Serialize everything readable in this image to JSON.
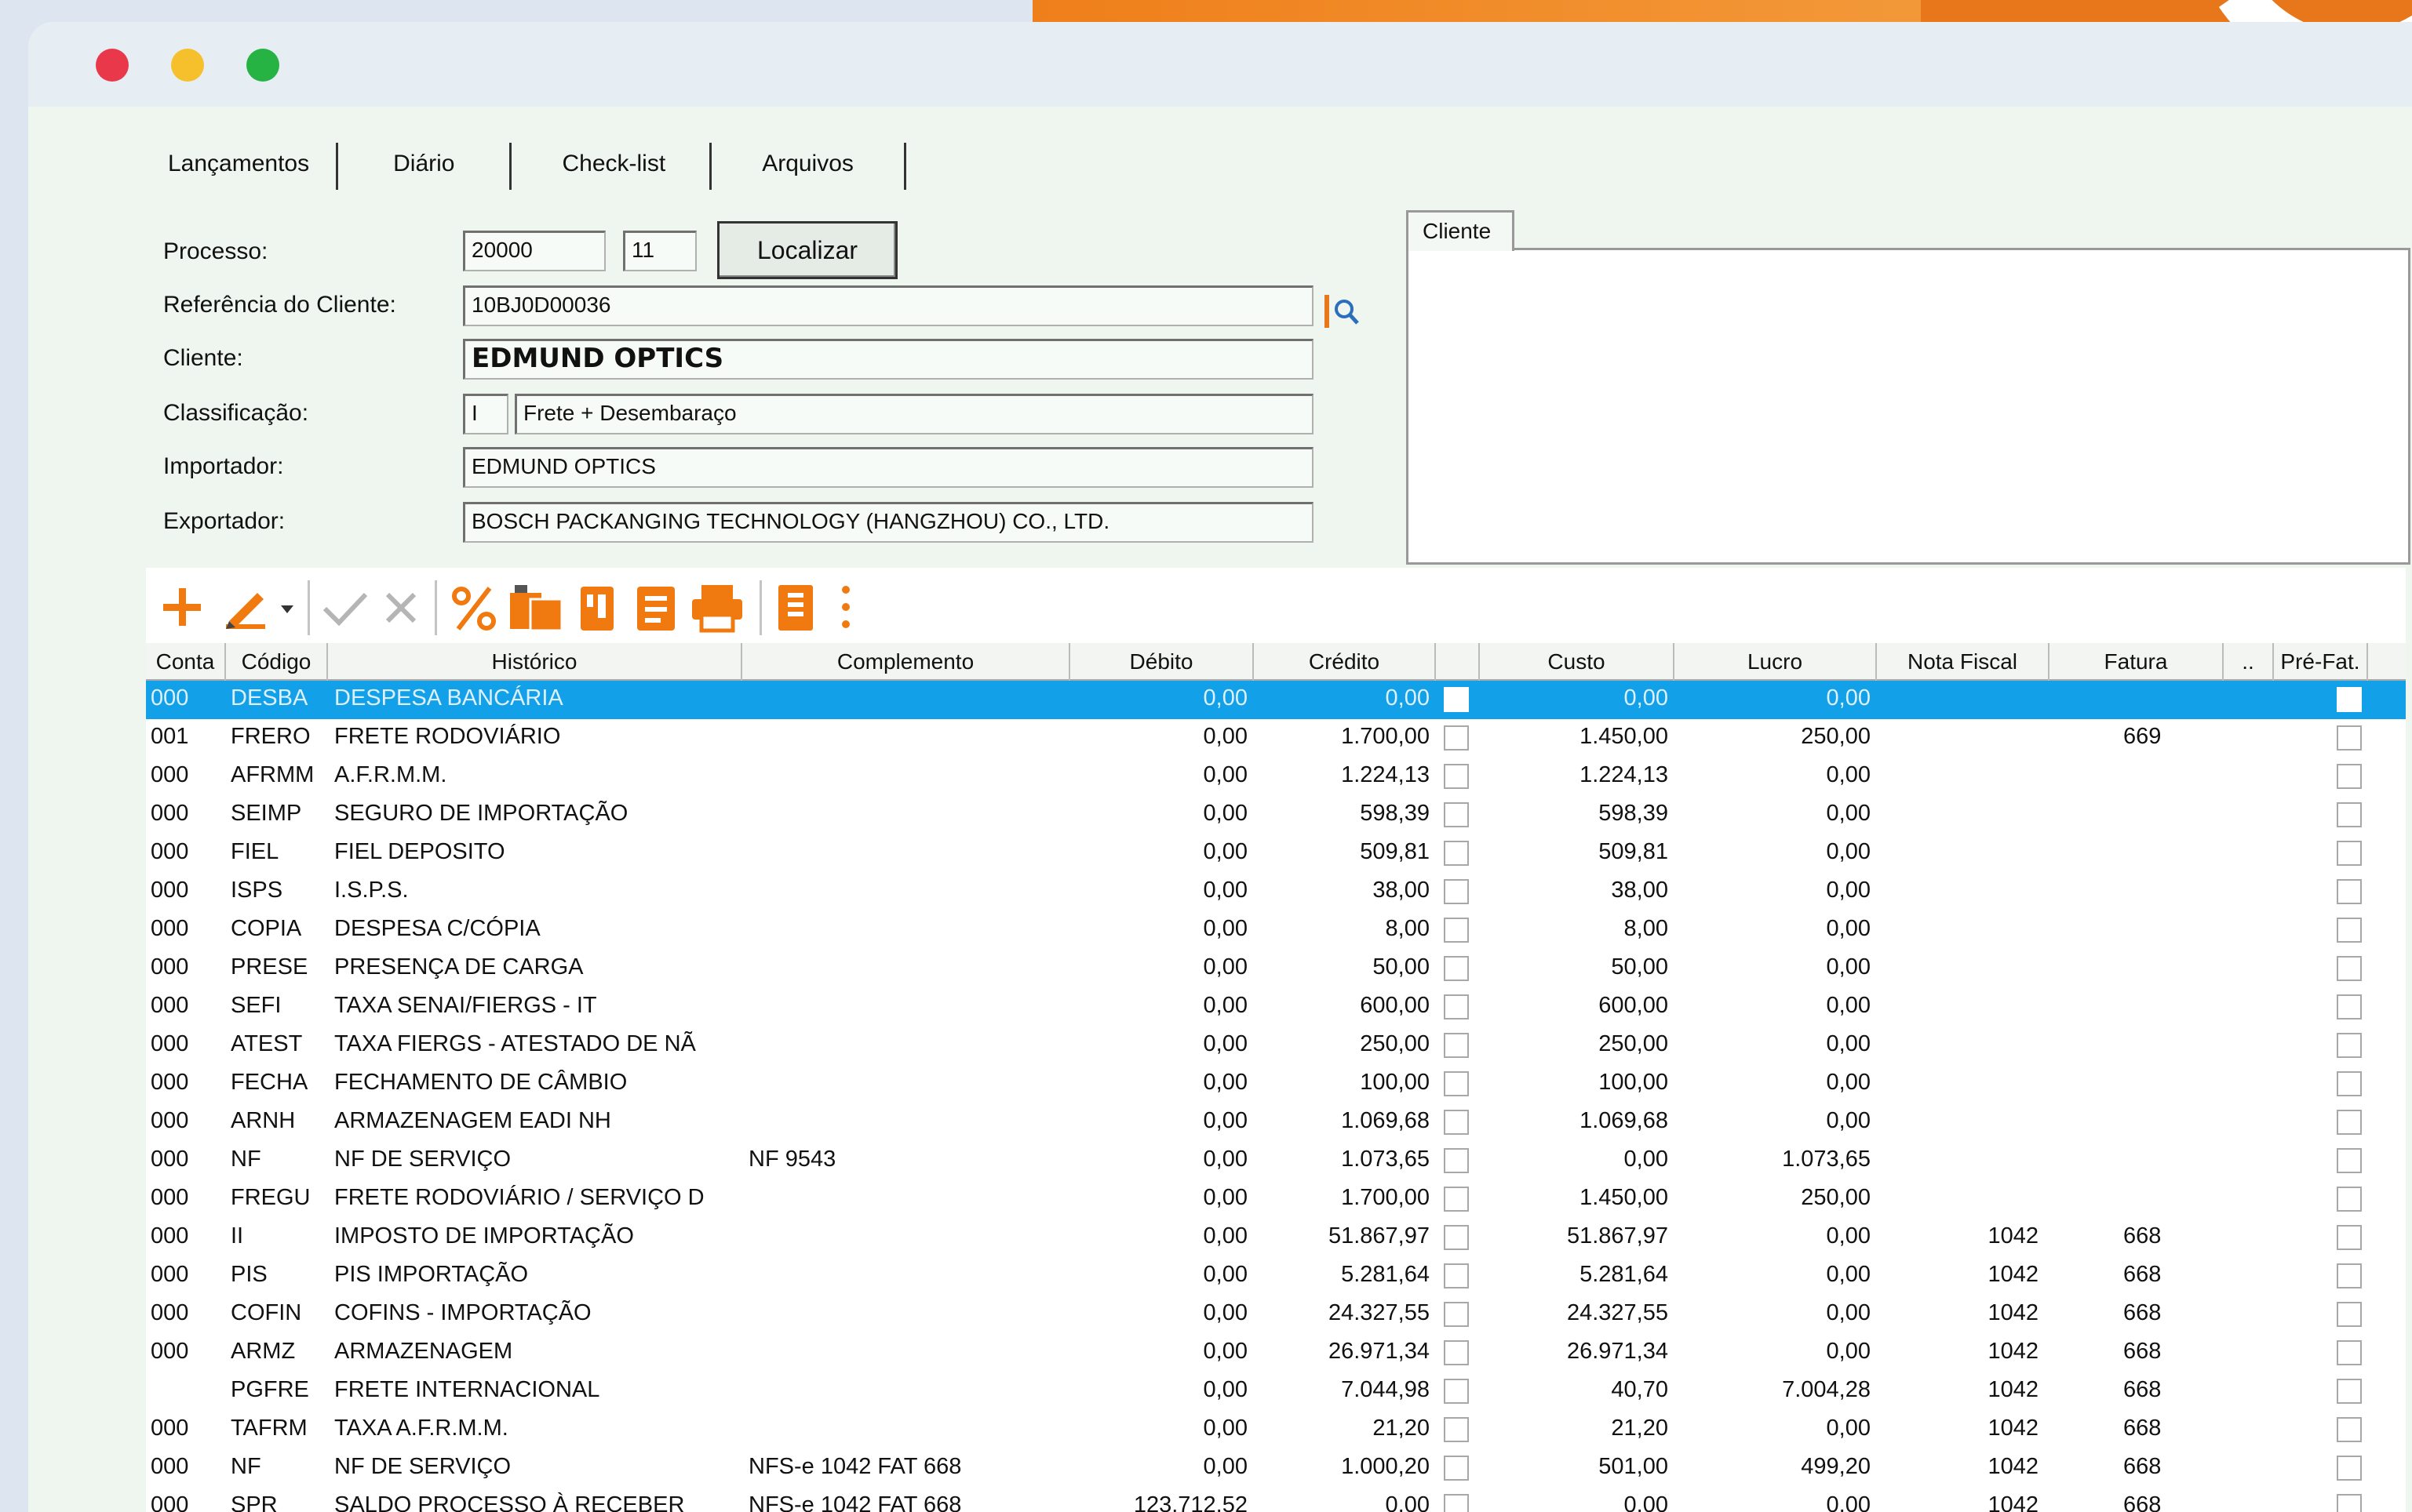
{
  "colors": {
    "accent": "#12a1e8",
    "brand_orange": "#e8761a",
    "red_light": "#e8384a",
    "yellow_light": "#f6c02c",
    "green_light": "#27b344"
  },
  "tabs": [
    "Lançamentos",
    "Diário",
    "Check-list",
    "Arquivos"
  ],
  "form": {
    "processo_label": "Processo:",
    "processo_value": "20000",
    "processo_seq": "11",
    "localizar_label": "Localizar",
    "referencia_label": "Referência do Cliente:",
    "referencia_value": "10BJ0D00036",
    "cliente_label": "Cliente:",
    "cliente_value": "EDMUND OPTICS",
    "classificacao_label": "Classificação:",
    "classificacao_code": "I",
    "classificacao_value": "Frete + Desembaraço",
    "importador_label": "Importador:",
    "importador_value": "EDMUND OPTICS",
    "exportador_label": "Exportador:",
    "exportador_value": "BOSCH PACKANGING TECHNOLOGY (HANGZHOU) CO., LTD."
  },
  "cliente_panel": {
    "tab_label": "Cliente"
  },
  "toolbar": {
    "icons": [
      "add-icon",
      "edit-icon",
      "dropdown-icon",
      "confirm-icon",
      "cancel-icon",
      "percent-icon",
      "folder-icon",
      "document-icon",
      "report-icon",
      "print-icon",
      "book-icon",
      "more-icon"
    ]
  },
  "grid": {
    "headers": [
      "Conta",
      "Código",
      "Histórico",
      "Complemento",
      "Débito",
      "Crédito",
      "",
      "Custo",
      "Lucro",
      "Nota Fiscal",
      "Fatura",
      "..",
      "Pré-Fat."
    ],
    "rows": [
      {
        "conta": "000",
        "codigo": "DESBA",
        "historico": "DESPESA BANCÁRIA",
        "complemento": "",
        "debito": "0,00",
        "credito": "0,00",
        "custo": "0,00",
        "lucro": "0,00",
        "nf": "",
        "fatura": "",
        "selected": true
      },
      {
        "conta": "001",
        "codigo": "FRERO",
        "historico": "FRETE RODOVIÁRIO",
        "complemento": "",
        "debito": "0,00",
        "credito": "1.700,00",
        "custo": "1.450,00",
        "lucro": "250,00",
        "nf": "",
        "fatura": "669"
      },
      {
        "conta": "000",
        "codigo": "AFRMM",
        "historico": "A.F.R.M.M.",
        "complemento": "",
        "debito": "0,00",
        "credito": "1.224,13",
        "custo": "1.224,13",
        "lucro": "0,00",
        "nf": "",
        "fatura": ""
      },
      {
        "conta": "000",
        "codigo": "SEIMP",
        "historico": "SEGURO DE IMPORTAÇÃO",
        "complemento": "",
        "debito": "0,00",
        "credito": "598,39",
        "custo": "598,39",
        "lucro": "0,00",
        "nf": "",
        "fatura": ""
      },
      {
        "conta": "000",
        "codigo": "FIEL",
        "historico": "FIEL DEPOSITO",
        "complemento": "",
        "debito": "0,00",
        "credito": "509,81",
        "custo": "509,81",
        "lucro": "0,00",
        "nf": "",
        "fatura": ""
      },
      {
        "conta": "000",
        "codigo": "ISPS",
        "historico": "I.S.P.S.",
        "complemento": "",
        "debito": "0,00",
        "credito": "38,00",
        "custo": "38,00",
        "lucro": "0,00",
        "nf": "",
        "fatura": ""
      },
      {
        "conta": "000",
        "codigo": "COPIA",
        "historico": "DESPESA C/CÓPIA",
        "complemento": "",
        "debito": "0,00",
        "credito": "8,00",
        "custo": "8,00",
        "lucro": "0,00",
        "nf": "",
        "fatura": ""
      },
      {
        "conta": "000",
        "codigo": "PRESE",
        "historico": "PRESENÇA DE CARGA",
        "complemento": "",
        "debito": "0,00",
        "credito": "50,00",
        "custo": "50,00",
        "lucro": "0,00",
        "nf": "",
        "fatura": ""
      },
      {
        "conta": "000",
        "codigo": "SEFI",
        "historico": "TAXA SENAI/FIERGS - IT",
        "complemento": "",
        "debito": "0,00",
        "credito": "600,00",
        "custo": "600,00",
        "lucro": "0,00",
        "nf": "",
        "fatura": ""
      },
      {
        "conta": "000",
        "codigo": "ATEST",
        "historico": "TAXA FIERGS - ATESTADO DE NÃ",
        "complemento": "",
        "debito": "0,00",
        "credito": "250,00",
        "custo": "250,00",
        "lucro": "0,00",
        "nf": "",
        "fatura": ""
      },
      {
        "conta": "000",
        "codigo": "FECHA",
        "historico": "FECHAMENTO DE CÂMBIO",
        "complemento": "",
        "debito": "0,00",
        "credito": "100,00",
        "custo": "100,00",
        "lucro": "0,00",
        "nf": "",
        "fatura": ""
      },
      {
        "conta": "000",
        "codigo": "ARNH",
        "historico": "ARMAZENAGEM EADI NH",
        "complemento": "",
        "debito": "0,00",
        "credito": "1.069,68",
        "custo": "1.069,68",
        "lucro": "0,00",
        "nf": "",
        "fatura": ""
      },
      {
        "conta": "000",
        "codigo": "NF",
        "historico": "NF DE SERVIÇO",
        "complemento": "NF 9543",
        "debito": "0,00",
        "credito": "1.073,65",
        "custo": "0,00",
        "lucro": "1.073,65",
        "nf": "",
        "fatura": ""
      },
      {
        "conta": "000",
        "codigo": "FREGU",
        "historico": "FRETE RODOVIÁRIO / SERVIÇO D",
        "complemento": "",
        "debito": "0,00",
        "credito": "1.700,00",
        "custo": "1.450,00",
        "lucro": "250,00",
        "nf": "",
        "fatura": ""
      },
      {
        "conta": "000",
        "codigo": "II",
        "historico": "IMPOSTO DE IMPORTAÇÃO",
        "complemento": "",
        "debito": "0,00",
        "credito": "51.867,97",
        "custo": "51.867,97",
        "lucro": "0,00",
        "nf": "1042",
        "fatura": "668"
      },
      {
        "conta": "000",
        "codigo": "PIS",
        "historico": "PIS IMPORTAÇÃO",
        "complemento": "",
        "debito": "0,00",
        "credito": "5.281,64",
        "custo": "5.281,64",
        "lucro": "0,00",
        "nf": "1042",
        "fatura": "668"
      },
      {
        "conta": "000",
        "codigo": "COFIN",
        "historico": "COFINS - IMPORTAÇÃO",
        "complemento": "",
        "debito": "0,00",
        "credito": "24.327,55",
        "custo": "24.327,55",
        "lucro": "0,00",
        "nf": "1042",
        "fatura": "668"
      },
      {
        "conta": "000",
        "codigo": "ARMZ",
        "historico": "ARMAZENAGEM",
        "complemento": "",
        "debito": "0,00",
        "credito": "26.971,34",
        "custo": "26.971,34",
        "lucro": "0,00",
        "nf": "1042",
        "fatura": "668"
      },
      {
        "conta": "",
        "codigo": "PGFRE",
        "historico": "FRETE INTERNACIONAL",
        "complemento": "",
        "debito": "0,00",
        "credito": "7.044,98",
        "custo": "40,70",
        "lucro": "7.004,28",
        "nf": "1042",
        "fatura": "668"
      },
      {
        "conta": "000",
        "codigo": "TAFRM",
        "historico": "TAXA A.F.R.M.M.",
        "complemento": "",
        "debito": "0,00",
        "credito": "21,20",
        "custo": "21,20",
        "lucro": "0,00",
        "nf": "1042",
        "fatura": "668"
      },
      {
        "conta": "000",
        "codigo": "NF",
        "historico": "NF DE SERVIÇO",
        "complemento": "NFS-e 1042 FAT 668",
        "debito": "0,00",
        "credito": "1.000,20",
        "custo": "501,00",
        "lucro": "499,20",
        "nf": "1042",
        "fatura": "668"
      },
      {
        "conta": "000",
        "codigo": "SPR",
        "historico": "SALDO PROCESSO À RECEBER",
        "complemento": "NFS-e 1042 FAT 668",
        "debito": "123.712,52",
        "credito": "0,00",
        "custo": "0,00",
        "lucro": "0,00",
        "nf": "1042",
        "fatura": "668"
      }
    ]
  }
}
